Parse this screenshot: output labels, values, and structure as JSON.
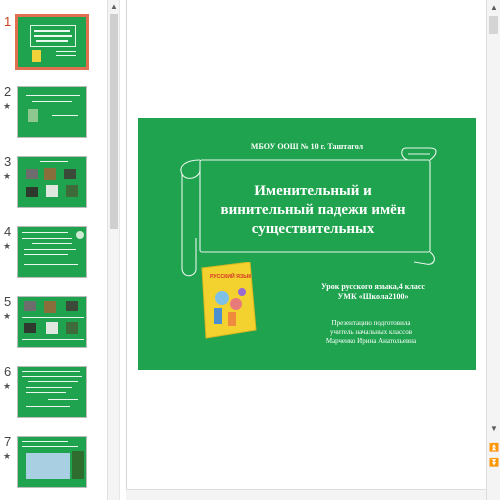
{
  "thumbnails": [
    {
      "number": "1",
      "active": true,
      "star": ""
    },
    {
      "number": "2",
      "active": false,
      "star": "★"
    },
    {
      "number": "3",
      "active": false,
      "star": "★"
    },
    {
      "number": "4",
      "active": false,
      "star": "★"
    },
    {
      "number": "5",
      "active": false,
      "star": "★"
    },
    {
      "number": "6",
      "active": false,
      "star": "★"
    },
    {
      "number": "7",
      "active": false,
      "star": "★"
    }
  ],
  "slide": {
    "school": "МБОУ ООШ № 10   г. Таштагол",
    "title_line1": "Именительный  и",
    "title_line2": "винительный падежи имён",
    "title_line3": "существительных",
    "lesson_line1": "Урок русского языка,4 класс",
    "lesson_line2": "УМК  «Школа2100»",
    "author_line1": "Презентацию подготовила",
    "author_line2": "учитель начальных классов",
    "author_line3": "Марченко Ирина Анатольевна",
    "book_label": "РУССКИЙ ЯЗЫК"
  },
  "colors": {
    "slide_green": "#1fa34f",
    "active_border": "#e07050"
  },
  "icons": {
    "scroll_up": "▲",
    "scroll_down": "▼",
    "prev_slide": "⏫",
    "next_slide": "⏬"
  }
}
